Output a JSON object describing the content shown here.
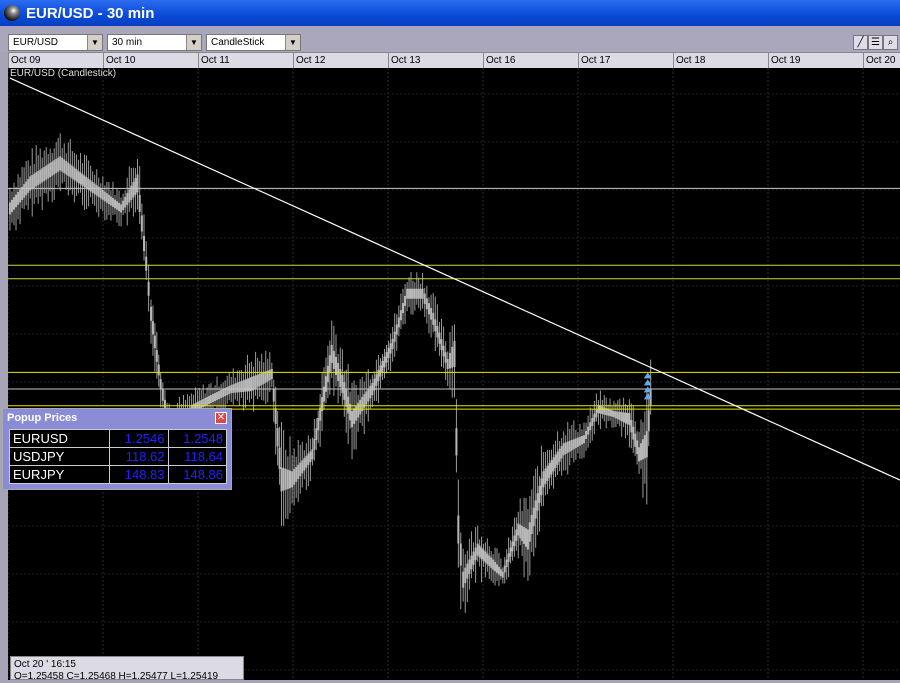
{
  "window": {
    "title": "EUR/USD - 30 min"
  },
  "toolbar": {
    "symbol": "EUR/USD",
    "interval": "30 min",
    "chart_type": "CandleStick",
    "tools": [
      "draw-line-icon",
      "hlines-icon",
      "zoom-icon"
    ]
  },
  "date_axis": [
    "Oct 09",
    "Oct 10",
    "Oct 11",
    "Oct 12",
    "Oct 13",
    "Oct 16",
    "Oct 17",
    "Oct 18",
    "Oct 19",
    "Oct 20"
  ],
  "chart_label": "EUR/USD (Candlestick)",
  "popup": {
    "title": "Popup Prices",
    "rows": [
      {
        "pair": "EURUSD",
        "bid": "1.2546",
        "ask": "1.2548"
      },
      {
        "pair": "USDJPY",
        "bid": "118.62",
        "ask": "118.64"
      },
      {
        "pair": "EURJPY",
        "bid": "148.83",
        "ask": "148.86"
      }
    ]
  },
  "status": {
    "time": "Oct 20 ' 16:15",
    "ohlc": "O=1.25458  C=1.25468  H=1.25477  L=1.25419"
  },
  "chart_data": {
    "type": "candlestick",
    "title": "EUR/USD (Candlestick)",
    "interval": "30 min",
    "x_unit": "days since Oct 09 (approx.)",
    "bars": [
      [
        0,
        1.2608,
        1.259
      ],
      [
        0.21,
        1.2617,
        1.2596
      ],
      [
        0.52,
        1.2623,
        1.2602
      ],
      [
        0.73,
        1.2617,
        1.2599
      ],
      [
        0.94,
        1.2611,
        1.2596
      ],
      [
        1.15,
        1.2605,
        1.2593
      ],
      [
        1.32,
        1.262,
        1.2593
      ],
      [
        1.41,
        1.2593,
        1.2572
      ],
      [
        1.46,
        1.2578,
        1.2557
      ],
      [
        1.56,
        1.2554,
        1.2539
      ],
      [
        1.67,
        1.2542,
        1.2518
      ],
      [
        1.88,
        1.2545,
        1.2533
      ],
      [
        2.08,
        1.2548,
        1.2536
      ],
      [
        2.29,
        1.2551,
        1.2539
      ],
      [
        2.5,
        1.2557,
        1.2536
      ],
      [
        2.71,
        1.2557,
        1.2542
      ],
      [
        2.81,
        1.2536,
        1.25
      ],
      [
        2.92,
        1.253,
        1.2506
      ],
      [
        3.13,
        1.2533,
        1.2518
      ],
      [
        3.33,
        1.2569,
        1.2542
      ],
      [
        3.44,
        1.256,
        1.2533
      ],
      [
        3.54,
        1.2548,
        1.2524
      ],
      [
        3.75,
        1.2554,
        1.2536
      ],
      [
        3.96,
        1.2566,
        1.2551
      ],
      [
        4.11,
        1.2581,
        1.2566
      ],
      [
        4.27,
        1.2581,
        1.2566
      ],
      [
        4.38,
        1.2575,
        1.2557
      ],
      [
        4.53,
        1.256,
        1.2545
      ],
      [
        4.6,
        1.2575,
        1.2536
      ],
      [
        4.64,
        1.2524,
        1.2482
      ],
      [
        4.69,
        1.25,
        1.2476
      ],
      [
        4.84,
        1.2506,
        1.2488
      ],
      [
        5,
        1.25,
        1.2485
      ],
      [
        5.1,
        1.2494,
        1.2485
      ],
      [
        5.26,
        1.2512,
        1.2494
      ],
      [
        5.36,
        1.2515,
        1.2485
      ],
      [
        5.52,
        1.253,
        1.2506
      ],
      [
        5.73,
        1.2536,
        1.2518
      ],
      [
        5.94,
        1.2536,
        1.2524
      ],
      [
        6.09,
        1.2545,
        1.2533
      ],
      [
        6.25,
        1.2542,
        1.2533
      ],
      [
        6.41,
        1.2545,
        1.2527
      ],
      [
        6.51,
        1.2536,
        1.2515
      ],
      [
        6.59,
        1.2548,
        1.2509
      ],
      [
        6.65,
        1.2557,
        1.2542
      ]
    ],
    "horizontal_lines": [
      {
        "price": 1.2605,
        "color": "#c8c8c8"
      },
      {
        "price": 1.2582,
        "color": "#c0e040"
      },
      {
        "price": 1.2578,
        "color": "#c0e040"
      },
      {
        "price": 1.255,
        "color": "#e8e800"
      },
      {
        "price": 1.2545,
        "color": "#c8c8c8"
      },
      {
        "price": 1.254,
        "color": "#e8e800"
      },
      {
        "price": 1.2539,
        "color": "#e8e800"
      }
    ],
    "trendline": {
      "from": [
        0,
        1.2638
      ],
      "to": [
        9.27,
        1.2517
      ],
      "color": "#ffffff"
    },
    "xlim": [
      -0.02,
      9.21
    ],
    "ylim": [
      1.2458,
      1.2641
    ]
  }
}
